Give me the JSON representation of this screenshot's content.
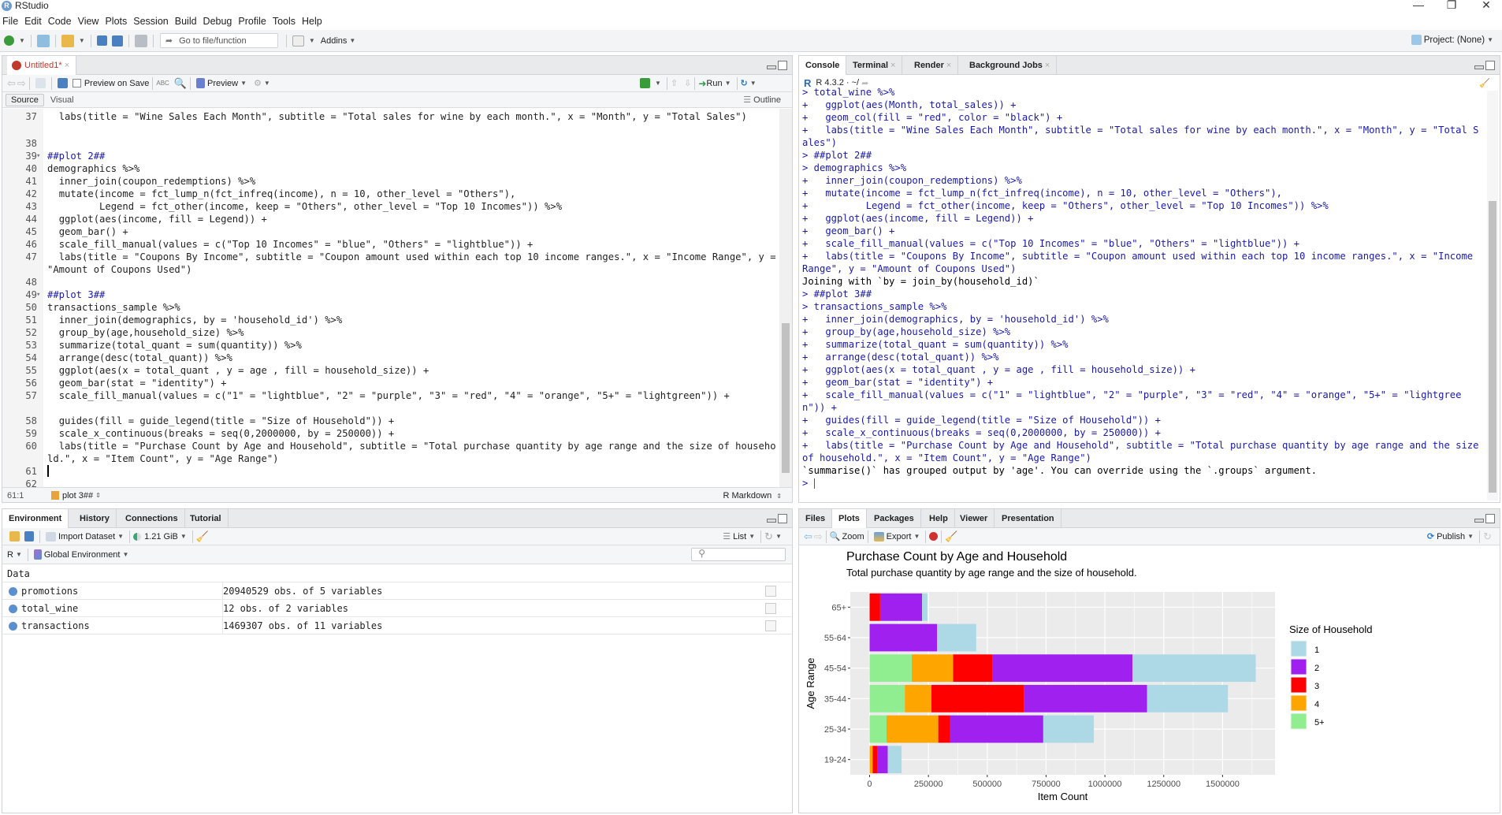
{
  "window": {
    "title": "RStudio",
    "minimize": "—",
    "restore": "❐",
    "close": "✕"
  },
  "menu": [
    "File",
    "Edit",
    "Code",
    "View",
    "Plots",
    "Session",
    "Build",
    "Debug",
    "Profile",
    "Tools",
    "Help"
  ],
  "toolbar": {
    "goto_placeholder": "Go to file/function",
    "addins": "Addins",
    "project": "Project: (None)"
  },
  "editor": {
    "tab": {
      "label": "Untitled1*",
      "close": "×"
    },
    "toolbar": {
      "preview_on_save": "Preview on Save",
      "preview": "Preview",
      "run": "Run"
    },
    "modes": {
      "source": "Source",
      "visual": "Visual",
      "outline": "Outline"
    },
    "lines": [
      {
        "n": "37",
        "text": "  labs(title = \"Wine Sales Each Month\", subtitle = \"Total sales for wine by each month.\", x = \"Month\", y = \"Total Sales\")",
        "wrap": true
      },
      {
        "n": "38",
        "text": ""
      },
      {
        "n": "39",
        "text": "##plot 2##",
        "comment": true,
        "fold": true
      },
      {
        "n": "40",
        "text": "demographics %>%"
      },
      {
        "n": "41",
        "text": "  inner_join(coupon_redemptions) %>%"
      },
      {
        "n": "42",
        "text": "  mutate(income = fct_lump_n(fct_infreq(income), n = 10, other_level = \"Others\"),"
      },
      {
        "n": "43",
        "text": "         Legend = fct_other(income, keep = \"Others\", other_level = \"Top 10 Incomes\")) %>%"
      },
      {
        "n": "44",
        "text": "  ggplot(aes(income, fill = Legend)) +"
      },
      {
        "n": "45",
        "text": "  geom_bar() +"
      },
      {
        "n": "46",
        "text": "  scale_fill_manual(values = c(\"Top 10 Incomes\" = \"blue\", \"Others\" = \"lightblue\")) +"
      },
      {
        "n": "47",
        "text": "  labs(title = \"Coupons By Income\", subtitle = \"Coupon amount used within each top 10 income ranges.\", x = \"Income Range\", y = \"Amount of Coupons Used\")",
        "wrap": true
      },
      {
        "n": "48",
        "text": ""
      },
      {
        "n": "49",
        "text": "##plot 3##",
        "comment": true,
        "fold": true
      },
      {
        "n": "50",
        "text": "transactions_sample %>%"
      },
      {
        "n": "51",
        "text": "  inner_join(demographics, by = 'household_id') %>%"
      },
      {
        "n": "52",
        "text": "  group_by(age,household_size) %>%"
      },
      {
        "n": "53",
        "text": "  summarize(total_quant = sum(quantity)) %>%"
      },
      {
        "n": "54",
        "text": "  arrange(desc(total_quant)) %>%"
      },
      {
        "n": "55",
        "text": "  ggplot(aes(x = total_quant , y = age , fill = household_size)) +"
      },
      {
        "n": "56",
        "text": "  geom_bar(stat = \"identity\") +"
      },
      {
        "n": "57",
        "text": "  scale_fill_manual(values = c(\"1\" = \"lightblue\", \"2\" = \"purple\", \"3\" = \"red\", \"4\" = \"orange\", \"5+\" = \"lightgreen\")) +",
        "wrap": true
      },
      {
        "n": "58",
        "text": "  guides(fill = guide_legend(title = \"Size of Household\")) +"
      },
      {
        "n": "59",
        "text": "  scale_x_continuous(breaks = seq(0,2000000, by = 250000)) +"
      },
      {
        "n": "60",
        "text": "  labs(title = \"Purchase Count by Age and Household\", subtitle = \"Total purchase quantity by age range and the size of household.\", x = \"Item Count\", y = \"Age Range\")",
        "wrap": true
      },
      {
        "n": "61",
        "text": ""
      },
      {
        "n": "62",
        "text": ""
      }
    ],
    "status": {
      "position": "61:1",
      "section": "plot 3##",
      "filetype": "R Markdown"
    }
  },
  "console": {
    "tabs": [
      {
        "label": "Console"
      },
      {
        "label": "Terminal"
      },
      {
        "label": "Render"
      },
      {
        "label": "Background Jobs"
      }
    ],
    "r_version": "R 4.3.2 · ~/",
    "lines": [
      {
        "t": "> total_wine %>%",
        "k": "in"
      },
      {
        "t": "+   ggplot(aes(Month, total_sales)) +",
        "k": "in"
      },
      {
        "t": "+   geom_col(fill = \"red\", color = \"black\") +",
        "k": "in"
      },
      {
        "t": "+   labs(title = \"Wine Sales Each Month\", subtitle = \"Total sales for wine by each month.\", x = \"Month\", y = \"Total Sales\")",
        "k": "in"
      },
      {
        "t": "> ##plot 2##",
        "k": "in"
      },
      {
        "t": "> demographics %>%",
        "k": "in"
      },
      {
        "t": "+   inner_join(coupon_redemptions) %>%",
        "k": "in"
      },
      {
        "t": "+   mutate(income = fct_lump_n(fct_infreq(income), n = 10, other_level = \"Others\"),",
        "k": "in"
      },
      {
        "t": "+          Legend = fct_other(income, keep = \"Others\", other_level = \"Top 10 Incomes\")) %>%",
        "k": "in"
      },
      {
        "t": "+   ggplot(aes(income, fill = Legend)) +",
        "k": "in"
      },
      {
        "t": "+   geom_bar() +",
        "k": "in"
      },
      {
        "t": "+   scale_fill_manual(values = c(\"Top 10 Incomes\" = \"blue\", \"Others\" = \"lightblue\")) +",
        "k": "in"
      },
      {
        "t": "+   labs(title = \"Coupons By Income\", subtitle = \"Coupon amount used within each top 10 income ranges.\", x = \"Income Range\", y = \"Amount of Coupons Used\")",
        "k": "in"
      },
      {
        "t": "Joining with `by = join_by(household_id)`",
        "k": "out"
      },
      {
        "t": "> ##plot 3##",
        "k": "in"
      },
      {
        "t": "> transactions_sample %>%",
        "k": "in"
      },
      {
        "t": "+   inner_join(demographics, by = 'household_id') %>%",
        "k": "in"
      },
      {
        "t": "+   group_by(age,household_size) %>%",
        "k": "in"
      },
      {
        "t": "+   summarize(total_quant = sum(quantity)) %>%",
        "k": "in"
      },
      {
        "t": "+   arrange(desc(total_quant)) %>%",
        "k": "in"
      },
      {
        "t": "+   ggplot(aes(x = total_quant , y = age , fill = household_size)) +",
        "k": "in"
      },
      {
        "t": "+   geom_bar(stat = \"identity\") +",
        "k": "in"
      },
      {
        "t": "+   scale_fill_manual(values = c(\"1\" = \"lightblue\", \"2\" = \"purple\", \"3\" = \"red\", \"4\" = \"orange\", \"5+\" = \"lightgreen\")) +",
        "k": "in"
      },
      {
        "t": "+   guides(fill = guide_legend(title = \"Size of Household\")) +",
        "k": "in"
      },
      {
        "t": "+   scale_x_continuous(breaks = seq(0,2000000, by = 250000)) +",
        "k": "in"
      },
      {
        "t": "+   labs(title = \"Purchase Count by Age and Household\", subtitle = \"Total purchase quantity by age range and the size of household.\", x = \"Item Count\", y = \"Age Range\")",
        "k": "in"
      },
      {
        "t": "`summarise()` has grouped output by 'age'. You can override using the `.groups` argument.",
        "k": "out"
      },
      {
        "t": "> ",
        "k": "in"
      }
    ]
  },
  "environment": {
    "tabs": [
      {
        "label": "Environment"
      },
      {
        "label": "History"
      },
      {
        "label": "Connections"
      },
      {
        "label": "Tutorial"
      }
    ],
    "import_dataset": "Import Dataset",
    "memory": "1.21 GiB",
    "view_mode": "List",
    "language": "R",
    "scope": "Global Environment",
    "search_placeholder": "",
    "section": "Data",
    "rows": [
      {
        "name": "promotions",
        "value": "20940529 obs. of 5 variables"
      },
      {
        "name": "total_wine",
        "value": "12 obs. of 2 variables"
      },
      {
        "name": "transactions",
        "value": "1469307 obs. of 11 variables"
      }
    ]
  },
  "plots_pane": {
    "tabs": [
      {
        "label": "Files"
      },
      {
        "label": "Plots"
      },
      {
        "label": "Packages"
      },
      {
        "label": "Help"
      },
      {
        "label": "Viewer"
      },
      {
        "label": "Presentation"
      }
    ],
    "zoom": "Zoom",
    "export": "Export",
    "publish": "Publish"
  },
  "chart_data": {
    "type": "bar",
    "orientation": "horizontal",
    "stacked": true,
    "title": "Purchase Count by Age and Household",
    "subtitle": "Total purchase quantity by age range and the size of household.",
    "xlabel": "Item Count",
    "ylabel": "Age Range",
    "xlim": [
      -82000,
      1723000
    ],
    "xticks": [
      0,
      250000,
      500000,
      750000,
      1000000,
      1250000,
      1500000
    ],
    "xtick_labels": [
      "0",
      "250000",
      "500000",
      "750000",
      "1000000",
      "1250000",
      "1500000"
    ],
    "categories": [
      "19-24",
      "25-34",
      "35-44",
      "45-54",
      "55-64",
      "65+"
    ],
    "legend": {
      "title": "Size of Household",
      "position": "right"
    },
    "grid": true,
    "series_stack_order": [
      "5+",
      "4",
      "3",
      "2",
      "1"
    ],
    "series": [
      {
        "name": "1",
        "color": "#ADD8E6",
        "values": [
          59000,
          215000,
          344000,
          524000,
          166000,
          23000
        ]
      },
      {
        "name": "2",
        "color": "#A020F0",
        "values": [
          43000,
          395000,
          524000,
          594000,
          287000,
          178000
        ]
      },
      {
        "name": "3",
        "color": "#FF0000",
        "values": [
          21000,
          51000,
          392000,
          168000,
          0,
          45000
        ]
      },
      {
        "name": "4",
        "color": "#FFA500",
        "values": [
          13000,
          220000,
          113000,
          176000,
          0,
          0
        ]
      },
      {
        "name": "5+",
        "color": "#90EE90",
        "values": [
          0,
          72000,
          150000,
          179000,
          0,
          0
        ]
      }
    ]
  }
}
